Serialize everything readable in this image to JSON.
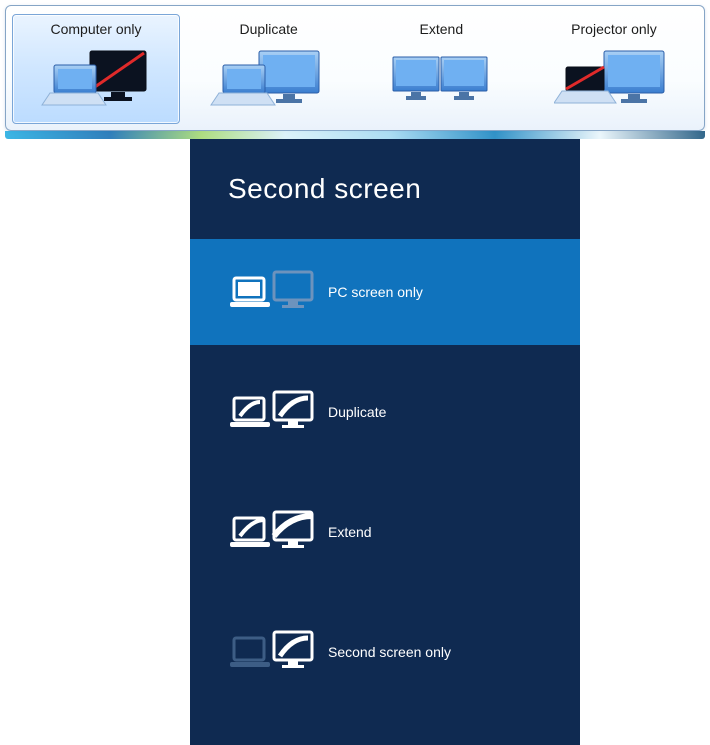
{
  "win7": {
    "options": [
      {
        "label": "Computer only",
        "selected": true
      },
      {
        "label": "Duplicate",
        "selected": false
      },
      {
        "label": "Extend",
        "selected": false
      },
      {
        "label": "Projector only",
        "selected": false
      }
    ]
  },
  "win8": {
    "title": "Second screen",
    "options": [
      {
        "label": "PC screen only",
        "selected": true
      },
      {
        "label": "Duplicate",
        "selected": false
      },
      {
        "label": "Extend",
        "selected": false
      },
      {
        "label": "Second screen only",
        "selected": false
      }
    ]
  }
}
